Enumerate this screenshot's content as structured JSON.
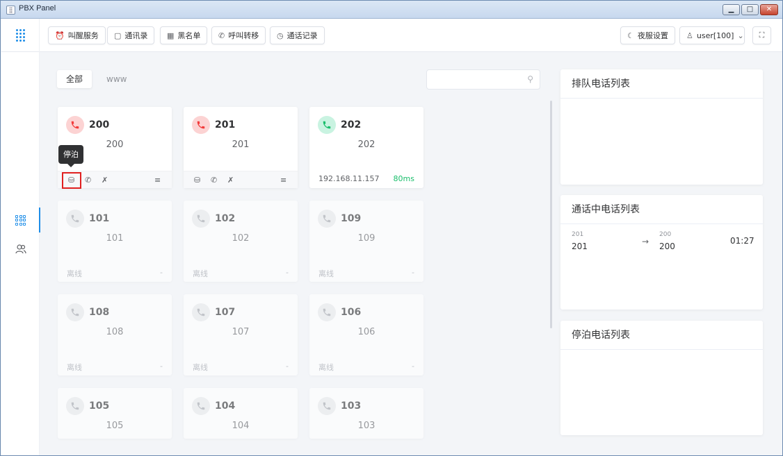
{
  "window": {
    "title": "PBX Panel",
    "app_icon": "phone-grid-icon",
    "min": "▁",
    "max": "□",
    "close": "✕"
  },
  "header": {
    "buttons": [
      {
        "icon": "alarm-clock-icon",
        "glyph": "⏰",
        "label": "叫醒服务"
      },
      {
        "icon": "address-book-icon",
        "glyph": "▢",
        "label": "通讯录"
      },
      {
        "icon": "blacklist-icon",
        "glyph": "▦",
        "label": "黑名单"
      },
      {
        "icon": "call-forward-icon",
        "glyph": "✆",
        "label": "呼叫转移"
      },
      {
        "icon": "clock-icon",
        "glyph": "◷",
        "label": "通话记录"
      }
    ],
    "night_service": {
      "icon": "moon-icon",
      "glyph": "☾",
      "label": "夜服设置"
    },
    "user": {
      "icon": "user-icon",
      "glyph": "♙",
      "label": "user[100]",
      "chevron": "⌄"
    },
    "fullscreen": {
      "icon": "fullscreen-icon",
      "glyph": "⛶"
    }
  },
  "tabs": [
    {
      "label": "全部",
      "active": true
    },
    {
      "label": "www",
      "active": false
    }
  ],
  "search": {
    "placeholder": "",
    "icon": "search-icon",
    "glyph": "⚲"
  },
  "tooltip": {
    "text": "停泊"
  },
  "extensions": [
    {
      "number": "200",
      "name": "200",
      "state": "busy",
      "footer": "actions"
    },
    {
      "number": "201",
      "name": "201",
      "state": "busy",
      "footer": "actions"
    },
    {
      "number": "202",
      "name": "202",
      "state": "idle",
      "footer": "ip",
      "ip": "192.168.11.157",
      "latency": "80ms"
    },
    {
      "number": "101",
      "name": "101",
      "state": "offline",
      "status": "离线",
      "dash": "-"
    },
    {
      "number": "102",
      "name": "102",
      "state": "offline",
      "status": "离线",
      "dash": "-"
    },
    {
      "number": "109",
      "name": "109",
      "state": "offline",
      "status": "离线",
      "dash": "-"
    },
    {
      "number": "108",
      "name": "108",
      "state": "offline",
      "status": "离线",
      "dash": "-"
    },
    {
      "number": "107",
      "name": "107",
      "state": "offline",
      "status": "离线",
      "dash": "-"
    },
    {
      "number": "106",
      "name": "106",
      "state": "offline",
      "status": "离线",
      "dash": "-"
    },
    {
      "number": "105",
      "name": "105",
      "state": "offline"
    },
    {
      "number": "104",
      "name": "104",
      "state": "offline"
    },
    {
      "number": "103",
      "name": "103",
      "state": "offline"
    }
  ],
  "card_actions": {
    "park": "停",
    "transfer": "✆",
    "hangup": "✗",
    "menu": "≡"
  },
  "panels": {
    "queue": {
      "title": "排队电话列表"
    },
    "active_calls": {
      "title": "通话中电话列表",
      "calls": [
        {
          "from_small": "201",
          "from": "201",
          "arrow": "→",
          "to_small": "200",
          "to": "200",
          "duration": "01:27"
        }
      ]
    },
    "parked": {
      "title": "停泊电话列表"
    }
  },
  "colors": {
    "accent": "#1f8ee8",
    "busy": "#f23b3b",
    "idle": "#19be6b",
    "offline": "#a3a7ad"
  }
}
